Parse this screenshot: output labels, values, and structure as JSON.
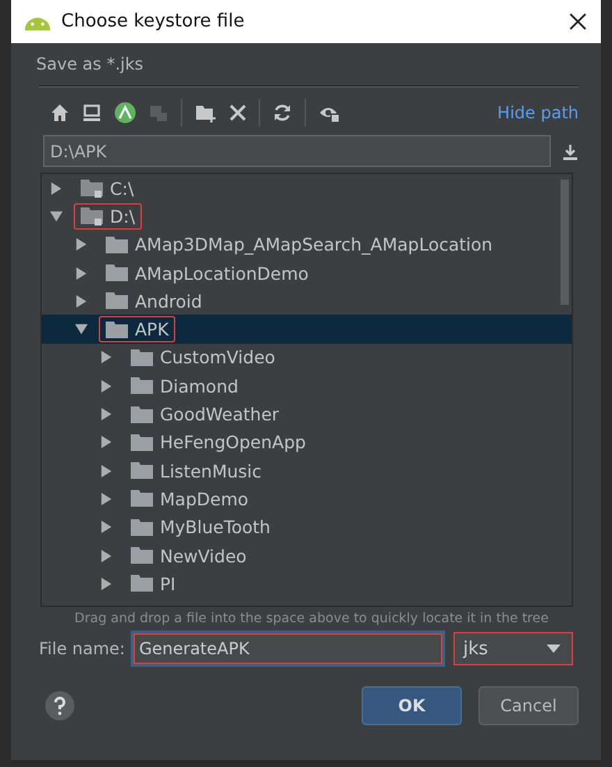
{
  "window": {
    "title": "Choose keystore file"
  },
  "description": "Save as *.jks",
  "toolbar": {
    "link": "Hide path"
  },
  "path_field": {
    "value": "D:\\APK"
  },
  "tree": [
    {
      "label": "C:\\",
      "kind": "drive",
      "expanded": false,
      "selected": false,
      "highlighted": false
    },
    {
      "label": "D:\\",
      "kind": "drive",
      "expanded": true,
      "selected": false,
      "highlighted": true,
      "children": [
        {
          "label": "AMap3DMap_AMapSearch_AMapLocation",
          "kind": "folder",
          "expanded": false,
          "selected": false,
          "highlighted": false
        },
        {
          "label": "AMapLocationDemo",
          "kind": "folder",
          "expanded": false,
          "selected": false,
          "highlighted": false
        },
        {
          "label": "Android",
          "kind": "folder",
          "expanded": false,
          "selected": false,
          "highlighted": false
        },
        {
          "label": "APK",
          "kind": "folder",
          "expanded": true,
          "selected": true,
          "highlighted": true,
          "children": [
            {
              "label": "CustomVideo",
              "kind": "folder",
              "expanded": false,
              "selected": false,
              "highlighted": false
            },
            {
              "label": "Diamond",
              "kind": "folder",
              "expanded": false,
              "selected": false,
              "highlighted": false
            },
            {
              "label": "GoodWeather",
              "kind": "folder",
              "expanded": false,
              "selected": false,
              "highlighted": false
            },
            {
              "label": "HeFengOpenApp",
              "kind": "folder",
              "expanded": false,
              "selected": false,
              "highlighted": false
            },
            {
              "label": "ListenMusic",
              "kind": "folder",
              "expanded": false,
              "selected": false,
              "highlighted": false
            },
            {
              "label": "MapDemo",
              "kind": "folder",
              "expanded": false,
              "selected": false,
              "highlighted": false
            },
            {
              "label": "MyBlueTooth",
              "kind": "folder",
              "expanded": false,
              "selected": false,
              "highlighted": false
            },
            {
              "label": "NewVideo",
              "kind": "folder",
              "expanded": false,
              "selected": false,
              "highlighted": false
            },
            {
              "label": "PI",
              "kind": "folder",
              "expanded": false,
              "selected": false,
              "highlighted": false
            }
          ]
        }
      ]
    }
  ],
  "hint": "Drag and drop a file into the space above to quickly locate it in the tree",
  "file_name": {
    "label": "File name:",
    "value": "GenerateAPK",
    "highlighted": true
  },
  "file_type": {
    "value": "jks",
    "highlighted": true
  },
  "buttons": [
    {
      "label": "OK",
      "kind": "primary"
    },
    {
      "label": "Cancel",
      "kind": "secondary"
    }
  ]
}
